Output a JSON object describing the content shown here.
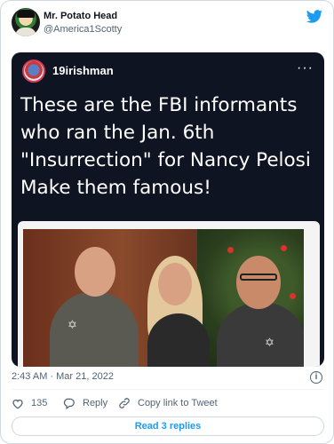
{
  "author": {
    "display_name": "Mr. Potato Head",
    "handle": "@America1Scotty",
    "avatar": "user-avatar",
    "platform_icon": "twitter-bird-icon"
  },
  "media": {
    "instagram_user": "19irishman",
    "more_icon": "ellipsis-icon",
    "more_label": "···",
    "caption_lines": [
      "These are the FBI informants",
      "who ran the Jan. 6th",
      "\"Insurrection\" for Nancy Pelosi",
      "Make them famous!"
    ]
  },
  "meta": {
    "timestamp": "2:43 AM · Mar 21, 2022",
    "info_icon": "info-icon",
    "info_label": "i"
  },
  "actions": {
    "like_count": "135",
    "reply_label": "Reply",
    "copy_label": "Copy link to Tweet"
  },
  "footer": {
    "read_replies_label": "Read 3 replies"
  },
  "colors": {
    "accent": "#1d9bf0",
    "like": "#f91880",
    "muted": "#536471",
    "media_bg": "#0e1421"
  }
}
